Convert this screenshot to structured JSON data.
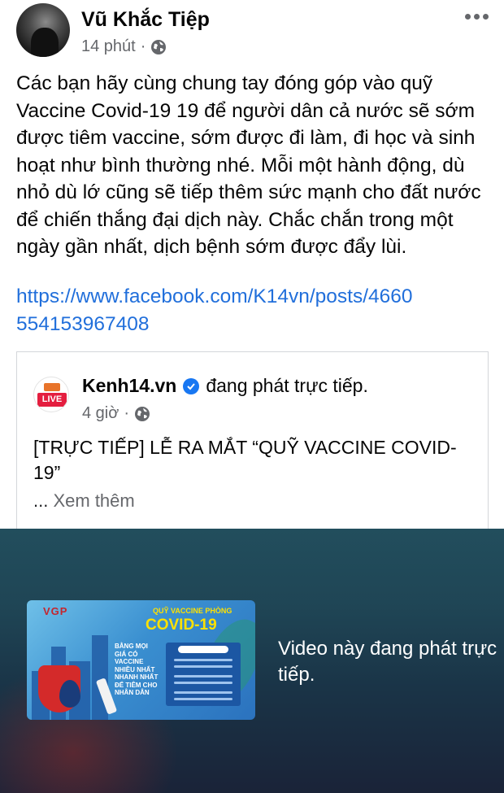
{
  "post": {
    "author_name": "Vũ Khắc Tiệp",
    "time": "14 phút",
    "separator": "·",
    "text": "Các bạn hãy cùng chung tay đóng góp vào quỹ Vaccine Covid-19 19 để người dân cả nước sẽ sớm được tiêm vaccine, sớm được đi làm, đi học và sinh hoạt như bình thường nhé. Mỗi một hành động, dù nhỏ dù lớ cũng sẽ tiếp thêm sức mạnh cho đất nước để chiến thắng đại dịch này. Chắc chắn trong một ngày gần nhất, dịch bệnh sớm được đẩy lùi.",
    "link": "https://www.facebook.com/K14vn/posts/4660554153967408"
  },
  "shared": {
    "page_name": "Kenh14.vn",
    "status": "đang phát trực tiếp.",
    "time": "4 giờ",
    "separator": "·",
    "avatar_badge": "LIVE",
    "title": "[TRỰC TIẾP] LỄ RA MẮT “QUỸ VACCINE COVID-19”",
    "ellipsis": "...",
    "see_more": "Xem thêm"
  },
  "video": {
    "note": "Video này đang phát trực tiếp.",
    "thumbnail": {
      "logo": "VGP",
      "fund_top": "QUỸ VACCINE PHÒNG",
      "fund_big": "COVID-19",
      "side_text": "BẰNG MỌI GIÁ CÓ VACCINE NHIỀU NHẤT NHANH NHẤT ĐỂ TIÊM CHO NHÂN DÂN"
    }
  },
  "icons": {
    "globe": "globe-icon",
    "more": "more-horizontal-icon",
    "verified": "verified-badge-icon"
  },
  "colors": {
    "link": "#216fdb",
    "meta": "#65676b",
    "verified": "#1877f2",
    "live": "#e41e3f"
  }
}
